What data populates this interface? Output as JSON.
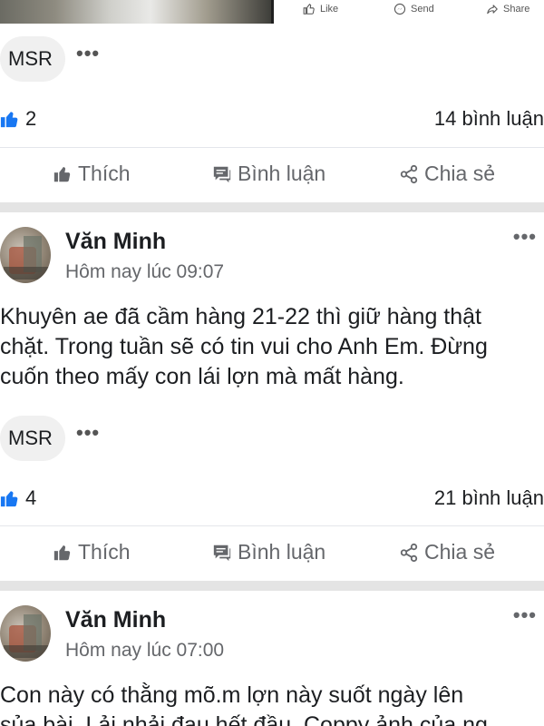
{
  "top_bar": {
    "like_label": "Like",
    "send_label": "Send",
    "share_label": "Share"
  },
  "first_post_footer": {
    "tag": "MSR",
    "more_glyph": "•••",
    "likes": "2",
    "comments": "14 bình luận"
  },
  "actions": {
    "like": "Thích",
    "comment": "Bình luận",
    "share": "Chia sẻ"
  },
  "posts": [
    {
      "author": "Văn Minh",
      "time": "Hôm nay lúc 09:07",
      "lines": [
        "Khuyên ae đã cầm hàng 21-22 thì giữ hàng thật",
        "chặt. Trong tuần sẽ có tin vui cho Anh Em. Đừng",
        "cuốn theo mấy con lái lợn mà mất hàng."
      ],
      "tag": "MSR",
      "likes": "4",
      "comments": "21 bình luận"
    },
    {
      "author": "Văn Minh",
      "time": "Hôm nay lúc 07:00",
      "lines": [
        "Con này có thằng mõ.m lợn này suốt ngày lên",
        "sủa bài. Lải nhải đau hết đầu. Coppy ảnh của ng"
      ]
    }
  ],
  "colors": {
    "like_blue": "#1877f2",
    "secondary_text": "#65676b",
    "separator": "#e4e4e4"
  },
  "icons": {
    "like": "thumbs-up-icon",
    "comment": "comment-icon",
    "share": "share-icon",
    "send": "messenger-icon",
    "more": "more-dots-icon"
  }
}
